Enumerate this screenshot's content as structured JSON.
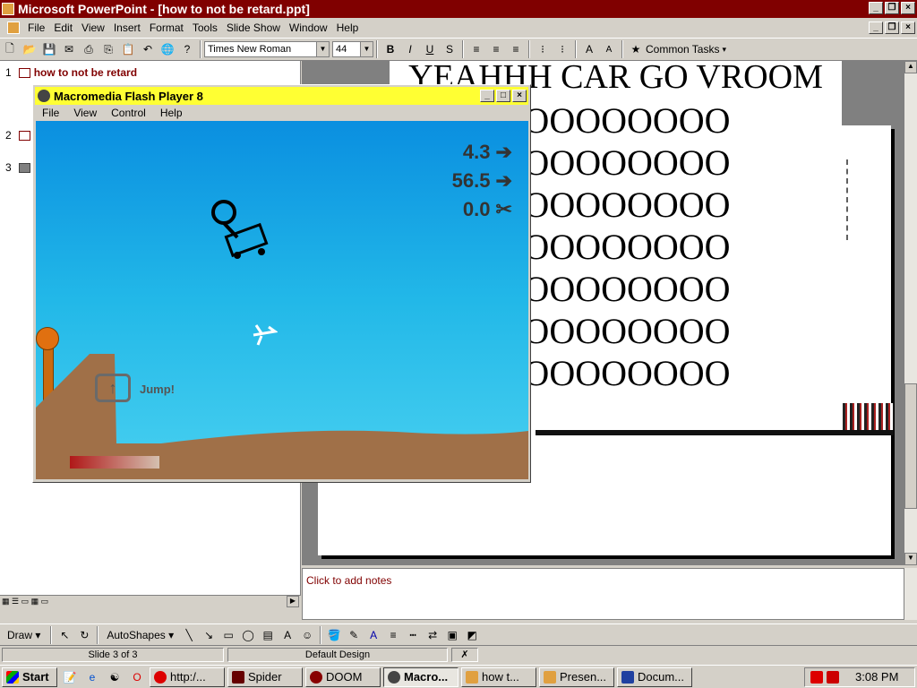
{
  "window": {
    "title": "Microsoft PowerPoint - [how to not be retard.ppt]"
  },
  "menu": [
    "File",
    "Edit",
    "View",
    "Insert",
    "Format",
    "Tools",
    "Slide Show",
    "Window",
    "Help"
  ],
  "toolbar": {
    "font": "Times New Roman",
    "size": "44",
    "common_tasks": "Common Tasks"
  },
  "outline": {
    "slide1_num": "1",
    "slide1_title": "how to not be retard",
    "slide2_num": "2",
    "slide3_num": "3"
  },
  "slide": {
    "title": "YEAHHH CAR GO VROOM",
    "lines": [
      "OOOOOOOOOOOOO",
      "OOOOOOOOOOOOO",
      "OOOOOOOOOOOOO",
      "OOOOOOOOOOOOO",
      "OOOOOOOOOOOOO",
      "OOOOOOOOOOOOO",
      "OOOOOOOOOOOOO"
    ]
  },
  "notes": {
    "placeholder": "Click to add notes"
  },
  "flash": {
    "title": "Macromedia Flash Player 8",
    "menu": [
      "File",
      "View",
      "Control",
      "Help"
    ],
    "speed": "4.3 ➔",
    "height": "56.5 ➔",
    "score": "0.0 ✂",
    "jump": "Jump!"
  },
  "drawbar": {
    "draw": "Draw ▾",
    "autoshapes": "AutoShapes ▾"
  },
  "status": {
    "slide": "Slide 3 of 3",
    "design": "Default Design"
  },
  "taskbar": {
    "start": "Start",
    "tasks": [
      "http:/...",
      "Spider",
      "DOOM",
      "Macro...",
      "how t...",
      "Presen...",
      "Docum..."
    ],
    "time": "3:08 PM"
  }
}
